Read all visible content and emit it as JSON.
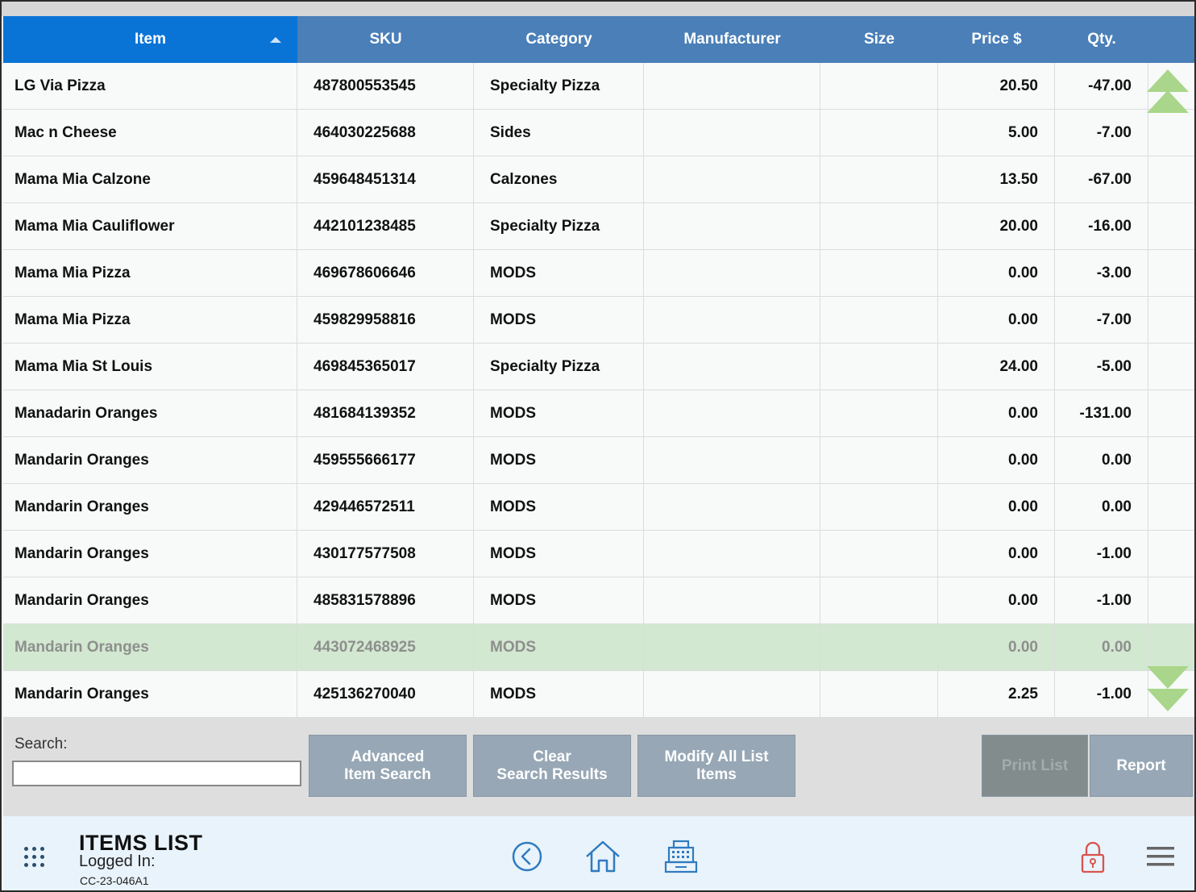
{
  "table": {
    "columns": {
      "item": "Item",
      "sku": "SKU",
      "category": "Category",
      "manufacturer": "Manufacturer",
      "size": "Size",
      "price": "Price $",
      "qty": "Qty."
    },
    "sort": {
      "column": "item",
      "direction": "ascending"
    },
    "selected_row": 12,
    "rows": [
      {
        "item": "LG Via Pizza",
        "sku": "487800553545",
        "category": "Specialty Pizza",
        "manufacturer": "",
        "size": "",
        "price": "20.50",
        "qty": "-47.00"
      },
      {
        "item": "Mac n Cheese",
        "sku": "464030225688",
        "category": "Sides",
        "manufacturer": "",
        "size": "",
        "price": "5.00",
        "qty": "-7.00"
      },
      {
        "item": "Mama Mia Calzone",
        "sku": "459648451314",
        "category": "Calzones",
        "manufacturer": "",
        "size": "",
        "price": "13.50",
        "qty": "-67.00"
      },
      {
        "item": "Mama Mia Cauliflower",
        "sku": "442101238485",
        "category": "Specialty Pizza",
        "manufacturer": "",
        "size": "",
        "price": "20.00",
        "qty": "-16.00"
      },
      {
        "item": "Mama Mia Pizza",
        "sku": "469678606646",
        "category": "MODS",
        "manufacturer": "",
        "size": "",
        "price": "0.00",
        "qty": "-3.00"
      },
      {
        "item": "Mama Mia Pizza",
        "sku": "459829958816",
        "category": "MODS",
        "manufacturer": "",
        "size": "",
        "price": "0.00",
        "qty": "-7.00"
      },
      {
        "item": "Mama Mia St Louis",
        "sku": "469845365017",
        "category": "Specialty Pizza",
        "manufacturer": "",
        "size": "",
        "price": "24.00",
        "qty": "-5.00"
      },
      {
        "item": "Manadarin Oranges",
        "sku": "481684139352",
        "category": "MODS",
        "manufacturer": "",
        "size": "",
        "price": "0.00",
        "qty": "-131.00"
      },
      {
        "item": "Mandarin Oranges",
        "sku": "459555666177",
        "category": "MODS",
        "manufacturer": "",
        "size": "",
        "price": "0.00",
        "qty": "0.00"
      },
      {
        "item": "Mandarin Oranges",
        "sku": "429446572511",
        "category": "MODS",
        "manufacturer": "",
        "size": "",
        "price": "0.00",
        "qty": "0.00"
      },
      {
        "item": "Mandarin Oranges",
        "sku": "430177577508",
        "category": "MODS",
        "manufacturer": "",
        "size": "",
        "price": "0.00",
        "qty": "-1.00"
      },
      {
        "item": "Mandarin Oranges",
        "sku": "485831578896",
        "category": "MODS",
        "manufacturer": "",
        "size": "",
        "price": "0.00",
        "qty": "-1.00"
      },
      {
        "item": "Mandarin Oranges",
        "sku": "443072468925",
        "category": "MODS",
        "manufacturer": "",
        "size": "",
        "price": "0.00",
        "qty": "0.00"
      },
      {
        "item": "Mandarin Oranges",
        "sku": "425136270040",
        "category": "MODS",
        "manufacturer": "",
        "size": "",
        "price": "2.25",
        "qty": "-1.00"
      }
    ]
  },
  "toolbar": {
    "search_label": "Search:",
    "search_value": "",
    "advanced_search_line1": "Advanced",
    "advanced_search_line2": "Item Search",
    "clear_line1": "Clear",
    "clear_line2": "Search Results",
    "modify_line1": "Modify All List",
    "modify_line2": "Items",
    "print_list": "Print List",
    "report": "Report"
  },
  "footer": {
    "title": "ITEMS LIST",
    "logged_in_label": "Logged In:",
    "station_id": "CC-23-046A1",
    "icons": [
      "apps-grid-icon",
      "back-icon",
      "home-icon",
      "register-icon",
      "lock-icon",
      "menu-icon"
    ]
  },
  "colors": {
    "header_blue": "#4a7fb8",
    "sorted_header_blue": "#0a74d6",
    "selected_row_green": "#d3e8d1",
    "scroll_arrow_green": "#a9d68a",
    "button_gray": "#97a7b5",
    "disabled_button_gray": "#828c8d",
    "footer_bg": "#e9f3fb",
    "icon_blue": "#2f7bbf",
    "lock_red": "#d9534f"
  }
}
